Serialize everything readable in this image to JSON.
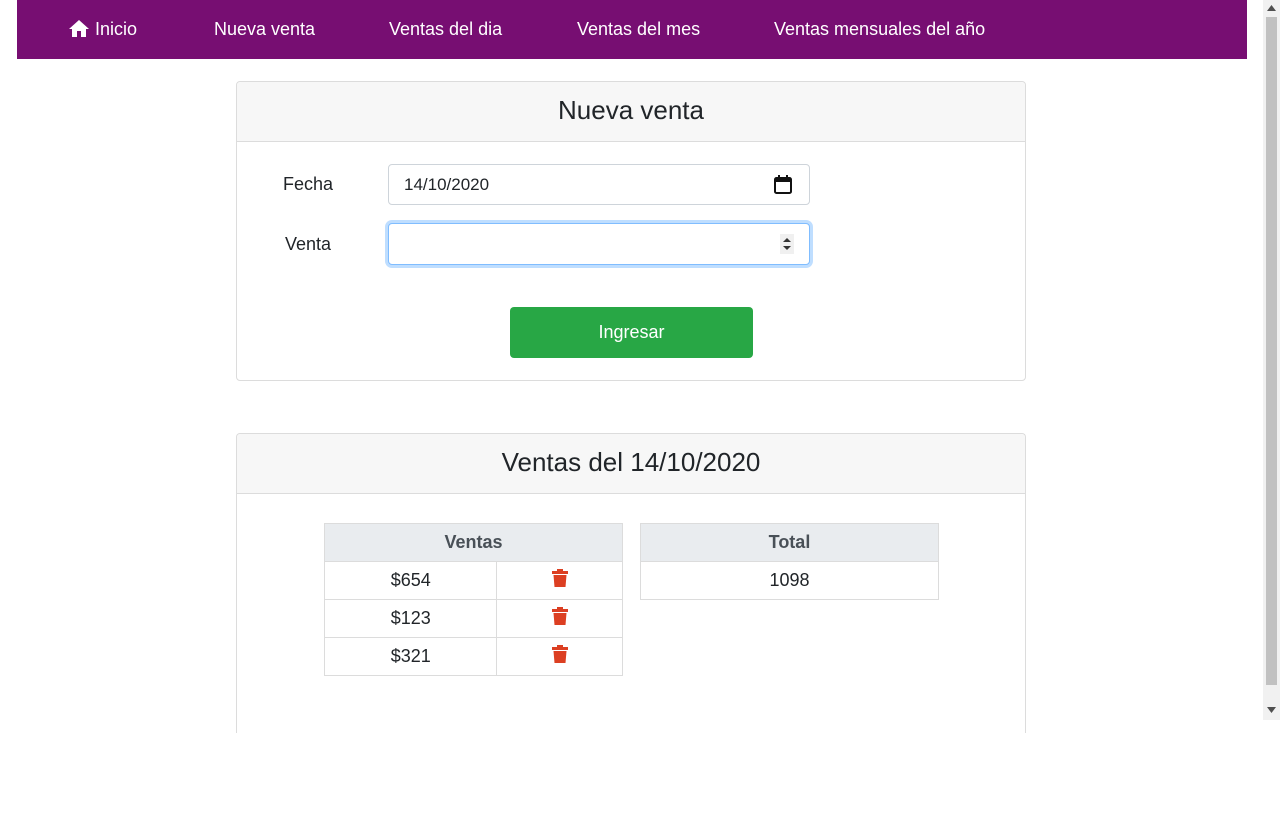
{
  "nav": {
    "items": [
      {
        "label": "Inicio",
        "icon": "home-icon"
      },
      {
        "label": "Nueva venta"
      },
      {
        "label": "Ventas del dia"
      },
      {
        "label": "Ventas del mes"
      },
      {
        "label": "Ventas mensuales del año"
      }
    ]
  },
  "form": {
    "title": "Nueva venta",
    "fecha_label": "Fecha",
    "fecha_value": "14/10/2020",
    "venta_label": "Venta",
    "venta_value": "",
    "submit_label": "Ingresar"
  },
  "sales": {
    "title": "Ventas del 14/10/2020",
    "ventas_header": "Ventas",
    "rows": [
      "$654",
      "$123",
      "$321"
    ],
    "total_header": "Total",
    "total_value": "1098"
  },
  "colors": {
    "nav_bg": "#770e72",
    "button_green": "#28a745",
    "trash_red": "#dc3f22"
  }
}
